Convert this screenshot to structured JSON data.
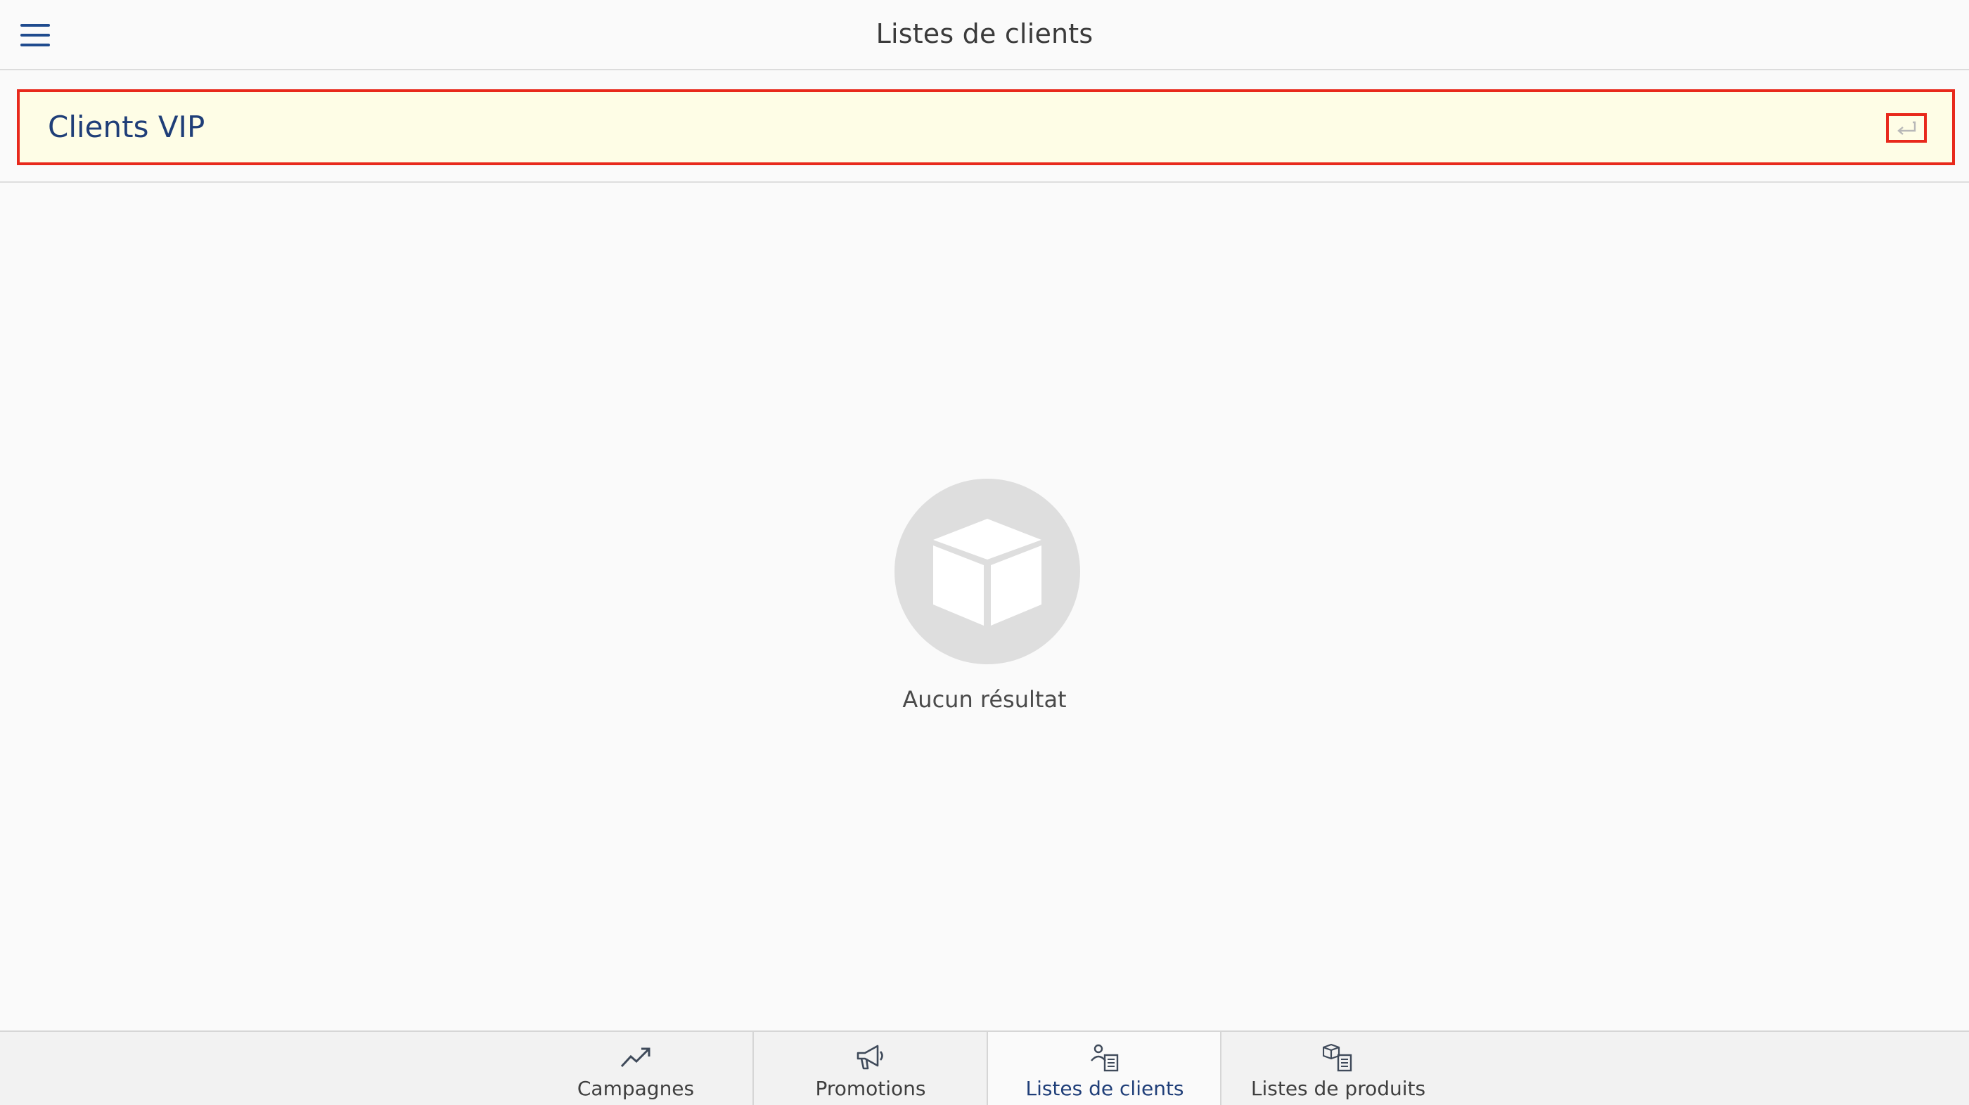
{
  "header": {
    "title": "Listes de clients"
  },
  "list_row": {
    "value": "Clients VIP"
  },
  "empty_state": {
    "message": "Aucun résultat"
  },
  "tabs": [
    {
      "label": "Campagnes",
      "icon": "trending-up-icon",
      "active": false
    },
    {
      "label": "Promotions",
      "icon": "megaphone-icon",
      "active": false
    },
    {
      "label": "Listes de clients",
      "icon": "client-list-icon",
      "active": true
    },
    {
      "label": "Listes de produits",
      "icon": "product-list-icon",
      "active": false
    }
  ],
  "colors": {
    "brand_blue": "#1f4b8e",
    "highlight_red": "#e8291c",
    "row_background": "#fefde6"
  }
}
